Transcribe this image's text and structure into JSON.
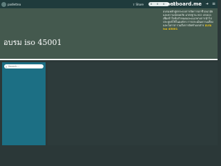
{
  "topbar": {
    "username": "padlettea",
    "share_label": "Share",
    "counters": [
      "0",
      "0",
      "0"
    ],
    "brand": "netboard.me",
    "icons": [
      "avatar",
      "bell-icon",
      "login-icon",
      "menu-icon"
    ]
  },
  "header": {
    "title": "อบรม iso 45001",
    "description_main": "อบรมหลักสูตรระบบการจัดการอาชีวอนามัยและความปลอดภัย มาตรฐาน ISO 45001 เพื่อเข้าใจข้อกำหนดและแนวทางการนำไปประยุกต์ใช้ในองค์กร การประเมินความเสี่ยงและโอกาส รวมถึงการจัดทำเอกสาร",
    "description_highlight": "อบรม iso 45001"
  },
  "sidebar": {
    "search_placeholder": "Search..."
  },
  "colors": {
    "topbar_bg": "#1f3b3c",
    "header_bg": "#44594e",
    "sidebar_bg": "#1c6f84",
    "highlight": "#f0c419"
  }
}
